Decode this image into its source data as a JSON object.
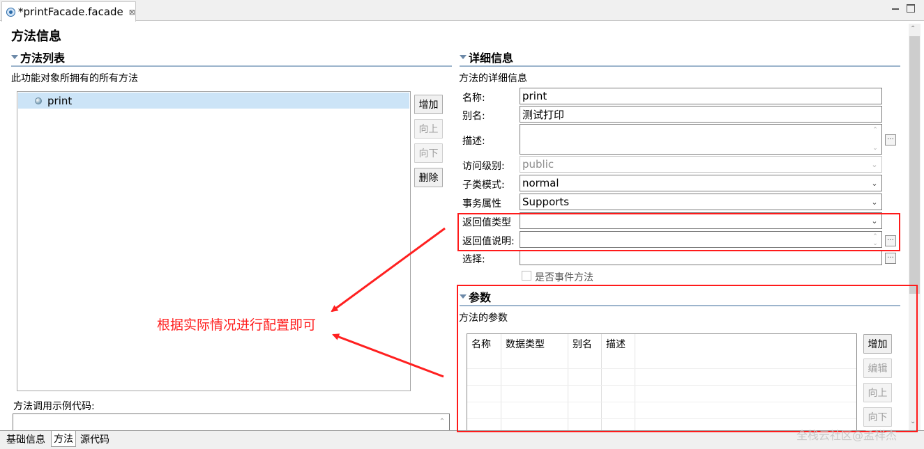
{
  "tab": {
    "title": "*printFacade.facade",
    "close": "⊠"
  },
  "page_title": "方法信息",
  "method_list": {
    "heading": "方法列表",
    "description": "此功能对象所拥有的所有方法",
    "items": [
      "print"
    ],
    "buttons": {
      "add": "增加",
      "up": "向上",
      "down": "向下",
      "delete": "删除"
    },
    "example_code_label": "方法调用示例代码:"
  },
  "detail": {
    "heading": "详细信息",
    "description": "方法的详细信息",
    "name_label": "名称:",
    "name_value": "print",
    "alias_label": "别名:",
    "alias_value": "测试打印",
    "desc_label": "描述:",
    "desc_value": "",
    "access_label": "访问级别:",
    "access_value": "public",
    "subclass_label": "子类模式:",
    "subclass_value": "normal",
    "tx_label": "事务属性",
    "tx_value": "Supports",
    "return_type_label": "返回值类型",
    "return_type_value": "",
    "return_desc_label": "返回值说明:",
    "return_desc_value": "",
    "select_label": "选择:",
    "select_value": "",
    "event_checkbox_label": "是否事件方法",
    "dots": "..."
  },
  "params": {
    "heading": "参数",
    "description": "方法的参数",
    "columns": [
      "名称",
      "数据类型",
      "别名",
      "描述"
    ],
    "buttons": {
      "add": "增加",
      "edit": "编辑",
      "up": "向上",
      "down": "向下"
    }
  },
  "bottom_tabs": [
    "基础信息",
    "方法",
    "源代码"
  ],
  "annotation": {
    "text": "根据实际情况进行配置即可",
    "color": "#ff2020"
  },
  "watermark": "全栈云社区@孟祥杰"
}
